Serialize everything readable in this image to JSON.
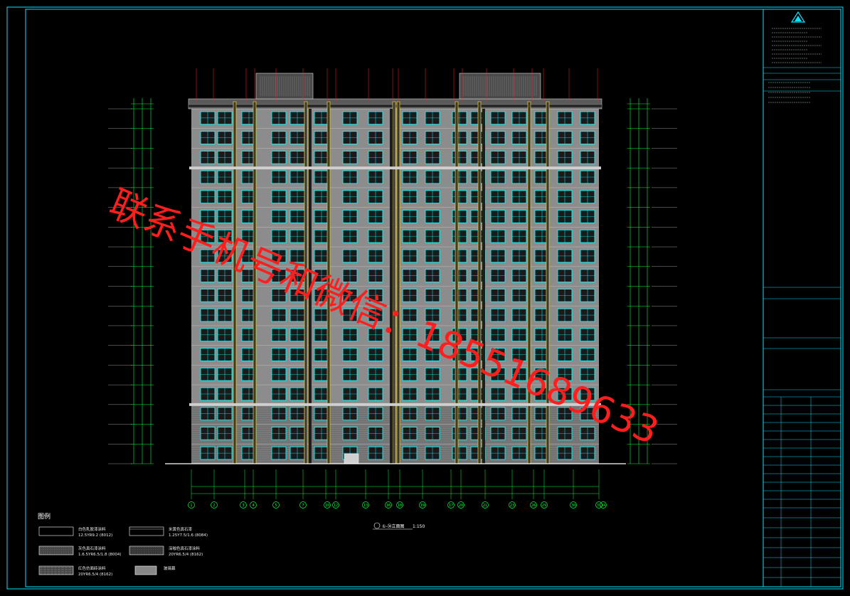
{
  "drawing": {
    "view_title": "①-㉞立面图",
    "view_scale": "1:150",
    "legend_title": "图例",
    "legend": [
      {
        "label": "白色乳胶漆涂料",
        "code": "12.5YR9.2 (8012)"
      },
      {
        "label": "米黄色真石漆",
        "code": "1.25Y7.5/1.6 (8084)"
      },
      {
        "label": "灰色真石漆涂料",
        "code": "1.6.5YR6.5/1.8 (8004)"
      },
      {
        "label": "深咖色真石漆涂料",
        "code": "20YR6.5/4 (8162)"
      },
      {
        "label": "红色仿面砖涂料",
        "code": "20YR6.5/4 (8162)"
      },
      {
        "label": "玻璃幕",
        "code": ""
      }
    ],
    "axis_labels": [
      "1",
      "2",
      "3",
      "4",
      "5",
      "7",
      "10",
      "12",
      "13",
      "16",
      "18",
      "19",
      "17",
      "20",
      "21",
      "23",
      "26",
      "29",
      "30",
      "31",
      "34"
    ],
    "watermark": "联系手机号和微信：18551689633",
    "colors": {
      "background": "#000000",
      "frame": "#00e5ff",
      "facade": "#8c8c8c",
      "window": "#00ffff",
      "column": "#f0d020",
      "dim_green": "#00ff3c",
      "grid_red": "#ff2020",
      "watermark": "#ff1e1e"
    },
    "icons": [
      "company-logo-icon"
    ]
  }
}
